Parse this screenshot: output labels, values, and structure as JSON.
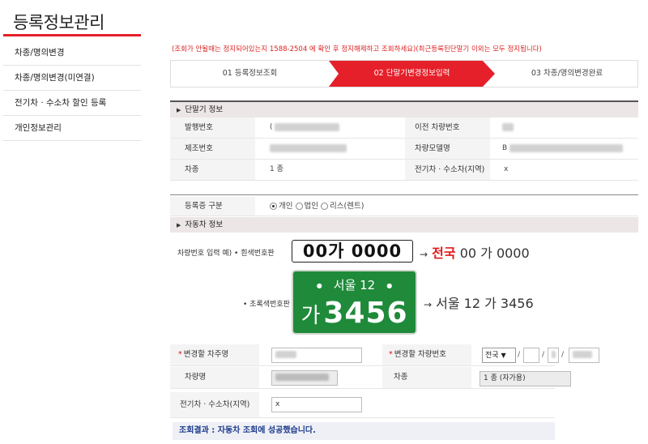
{
  "sidebar": {
    "title": "등록정보관리",
    "items": [
      {
        "label": "차종/명의변경"
      },
      {
        "label": "차종/명의변경(미연결)"
      },
      {
        "label": "전기차 · 수소차 할인 등록"
      },
      {
        "label": "개인정보관리"
      }
    ]
  },
  "notice": "(조회가 안될때는 정지되어있는지 1588-2504 에 확인 후 정지해제하고 조회하세요)(최근등록된단말기 이외는 모두 정지됩니다)",
  "steps": [
    {
      "label": "01 등록정보조회"
    },
    {
      "label": "02 단말기변경정보입력"
    },
    {
      "label": "03 차종/명의변경완료"
    }
  ],
  "colors": {
    "accent": "#e5202a",
    "plate_green": "#1f8a3a",
    "result_text": "#1d3a8a"
  },
  "terminal": {
    "heading": "단말기 정보",
    "issue_no_label": "발행번호",
    "issue_no_value": "(",
    "prev_plate_label": "이전 차량번호",
    "maker_no_label": "제조번호",
    "maker_no_value": "",
    "model_label": "차량모델명",
    "model_value": "B",
    "class_label": "차종",
    "class_value": "1   종",
    "ev_label": "전기차 · 수소차(지역)",
    "ev_value": "x"
  },
  "registration": {
    "label": "등록증 구분",
    "options": [
      {
        "label": "개인",
        "checked": true
      },
      {
        "label": "법인",
        "checked": false
      },
      {
        "label": "리스(렌트)",
        "checked": false
      }
    ]
  },
  "vehicle": {
    "heading": "자동차 정보",
    "example_label": "차량번호 입력 예) • 흰색번호판",
    "white_plate": "00가 0000",
    "white_arrow_red": "전국",
    "white_arrow_rest": " 00 가 0000",
    "green_label": "• 초록색번호판",
    "green_top": "서울 12",
    "green_ga": "가",
    "green_num": "3456",
    "green_arrow": "서울 12 가 3456"
  },
  "form": {
    "owner_label": "변경할 차주명",
    "plate_label": "변경할 차량번호",
    "region_select": "전국",
    "car_name_label": "차량명",
    "class_label": "차종",
    "class_value": "1 종 (자가용)",
    "ev_label": "전기차 · 수소차(지역)",
    "ev_value": "x"
  },
  "result": "조회결과 : 자동차 조회에 성공했습니다."
}
